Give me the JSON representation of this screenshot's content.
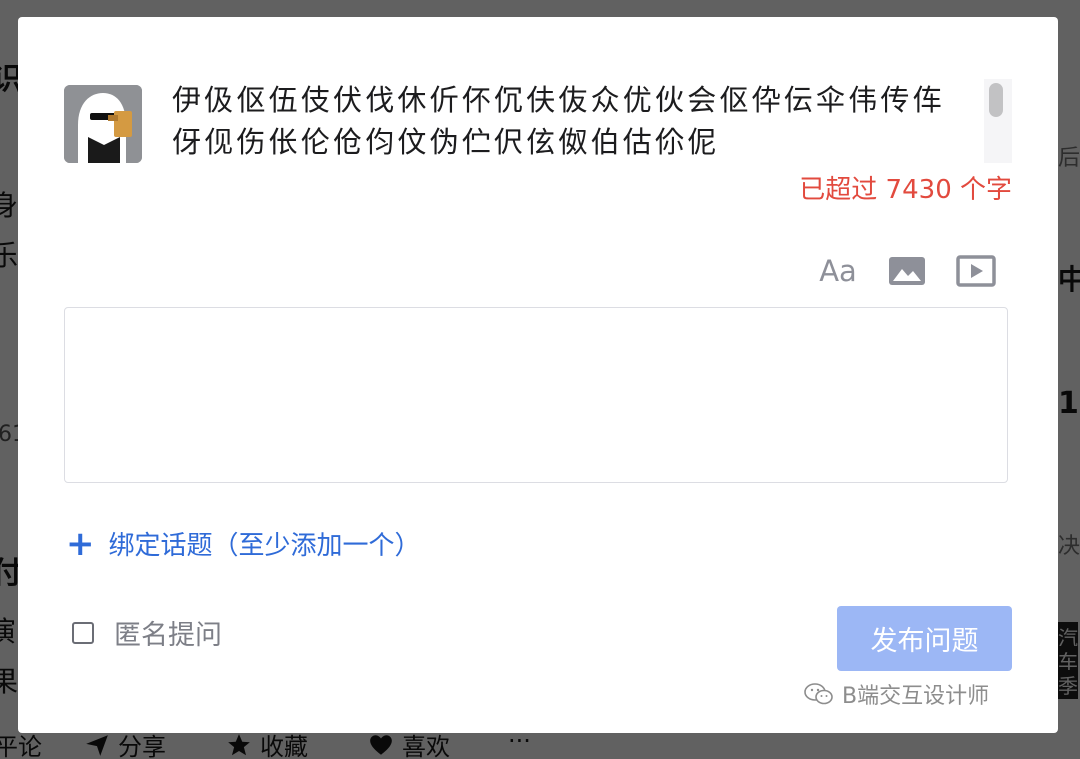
{
  "background": {
    "left_fragments": [
      "识",
      "身",
      "乐",
      "61",
      "付",
      "演",
      "果"
    ],
    "right_fragments": [
      "后",
      "中",
      "1",
      "决",
      "汽",
      "车",
      "季"
    ],
    "bottom_actions": [
      {
        "icon": "send-icon",
        "label": "分享"
      },
      {
        "icon": "star-icon",
        "label": "收藏"
      },
      {
        "icon": "heart-icon",
        "label": "喜欢"
      },
      {
        "icon": "more-icon",
        "label": "···"
      }
    ],
    "bottom_left_fragment": "平论"
  },
  "modal": {
    "question_text": "伊伋伛伍伎伏伐休伒伓伔伕伖众优伙会伛伜伝伞伟传伡伢伣伤伥伦伧伨伩伪伫伬伭伮伯估伱伲",
    "exceed_notice": "已超过 7430 个字",
    "toolbar": {
      "font_label": "Aa",
      "image_icon": "image-icon",
      "video_icon": "video-icon"
    },
    "editor_placeholder": "",
    "topic_link": {
      "plus": "+",
      "label": "绑定话题（至少添加一个）"
    },
    "anonymous": {
      "label": "匿名提问",
      "checked": false
    },
    "publish_button": "发布问题"
  },
  "watermark": "B端交互设计师",
  "colors": {
    "accent": "#2f6bd8",
    "publish_disabled": "#9cb7f5",
    "warning": "#e24a3e",
    "overlay": "rgba(0,0,0,0.62)"
  }
}
